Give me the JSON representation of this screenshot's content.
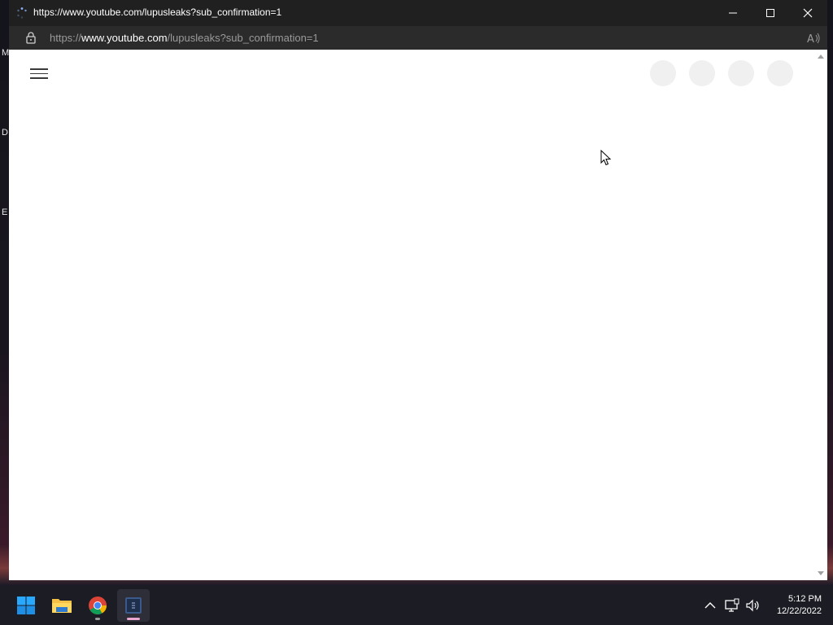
{
  "desktop": {
    "labels": [
      "M",
      "D",
      "E"
    ]
  },
  "window": {
    "title": "https://www.youtube.com/lupusleaks?sub_confirmation=1",
    "controls": [
      "minimize",
      "maximize",
      "close"
    ]
  },
  "address_bar": {
    "scheme": "https://",
    "host": "www.youtube.com",
    "path": "/lupusleaks?sub_confirmation=1"
  },
  "page": {
    "placeholder_count": 4
  },
  "taskbar": {
    "apps": [
      "start",
      "file-explorer",
      "chrome",
      "active-window"
    ],
    "clock": {
      "time": "5:12 PM",
      "date": "12/22/2022"
    }
  },
  "colors": {
    "titlebar": "#202020",
    "addressbar": "#2b2b2b",
    "taskbar": "#1c1c24",
    "page_background": "#ffffff",
    "placeholder": "#f0f0f0",
    "windows_blue": "#0078d4"
  }
}
